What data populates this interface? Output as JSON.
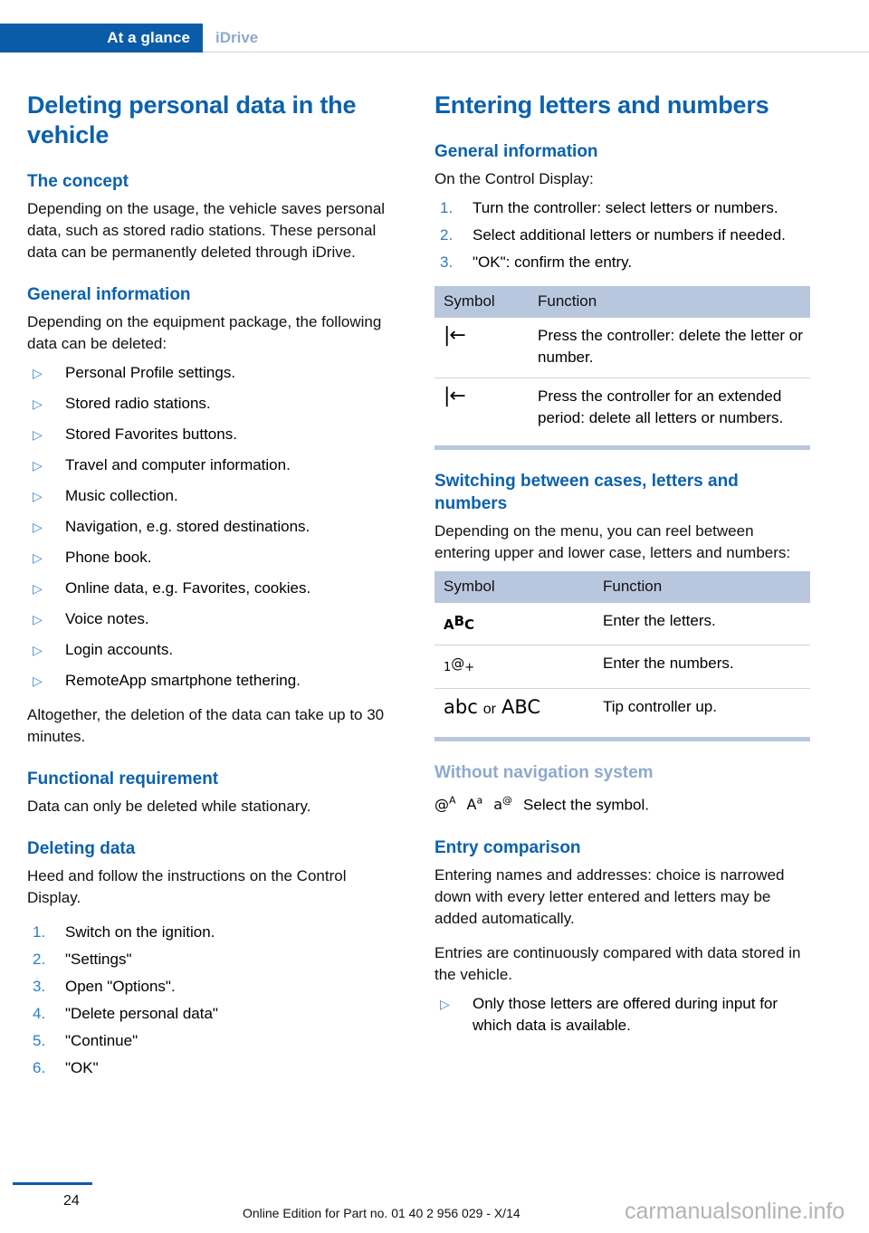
{
  "header": {
    "active_tab": "At a glance",
    "inactive_tab": "iDrive",
    "accent_color": "#0a5ca8"
  },
  "left_column": {
    "title": "Deleting personal data in the vehicle",
    "sections": {
      "concept_heading": "The concept",
      "concept_text": "Depending on the usage, the vehicle saves personal data, such as stored radio stations. These personal data can be permanently deleted through iDrive.",
      "general_heading": "General information",
      "general_text": "Depending on the equipment package, the following data can be deleted:",
      "bullet_items": [
        "Personal Profile settings.",
        "Stored radio stations.",
        "Stored Favorites buttons.",
        "Travel and computer information.",
        "Music collection.",
        "Navigation, e.g. stored destinations.",
        "Phone book.",
        "Online data, e.g. Favorites, cookies.",
        "Voice notes.",
        "Login accounts.",
        "RemoteApp smartphone tethering."
      ],
      "altogether_text": "Altogether, the deletion of the data can take up to 30 minutes.",
      "functional_heading": "Functional requirement",
      "functional_text": "Data can only be deleted while stationary.",
      "deleting_heading": "Deleting data",
      "deleting_text": "Heed and follow the instructions on the Control Display.",
      "deleting_steps": [
        "Switch on the ignition.",
        "\"Settings\"",
        "Open \"Options\".",
        "\"Delete personal data\"",
        "\"Continue\"",
        "\"OK\""
      ]
    }
  },
  "right_column": {
    "title": "Entering letters and numbers",
    "sections": {
      "general_heading": "General information",
      "general_text": "On the Control Display:",
      "general_steps": [
        "Turn the controller: select letters or numbers.",
        "Select additional letters or numbers if needed.",
        "\"OK\": confirm the entry."
      ],
      "table_delete": {
        "columns": [
          "Symbol",
          "Function"
        ],
        "rows": [
          {
            "symbol": "|←",
            "symbol_name": "delete-character-icon",
            "function": "Press the controller: delete the letter or number."
          },
          {
            "symbol": "|←",
            "symbol_name": "delete-all-icon",
            "function": "Press the controller for an extended period: delete all letters or numbers."
          }
        ]
      },
      "switching_heading": "Switching between cases, letters and numbers",
      "switching_text": "Depending on the menu, you can reel between entering upper and lower case, letters and numbers:",
      "table_switch": {
        "columns": [
          "Symbol",
          "Function"
        ],
        "rows": [
          {
            "symbol": "AᴮC",
            "symbol_name": "letters-icon",
            "function": "Enter the letters."
          },
          {
            "symbol": "1@+",
            "symbol_name": "numbers-icon",
            "function": "Enter the numbers."
          },
          {
            "symbol": "abc or ABC",
            "symbol_name": "case-toggle-icon",
            "function": "Tip controller up."
          }
        ]
      },
      "without_nav_heading": "Without navigation system",
      "without_nav_symbols": [
        "@ᴬ",
        "Aᵃ",
        "a@"
      ],
      "without_nav_text": "Select the symbol.",
      "entry_heading": "Entry comparison",
      "entry_text_1": "Entering names and addresses: choice is narrowed down with every letter entered and letters may be added automatically.",
      "entry_text_2": "Entries are continuously compared with data stored in the vehicle.",
      "entry_bullets": [
        "Only those letters are offered during input for which data is available."
      ]
    }
  },
  "footer": {
    "page_number": "24",
    "edition": "Online Edition for Part no. 01 40 2 956 029 - X/14",
    "watermark": "carmanualsonline.info"
  }
}
